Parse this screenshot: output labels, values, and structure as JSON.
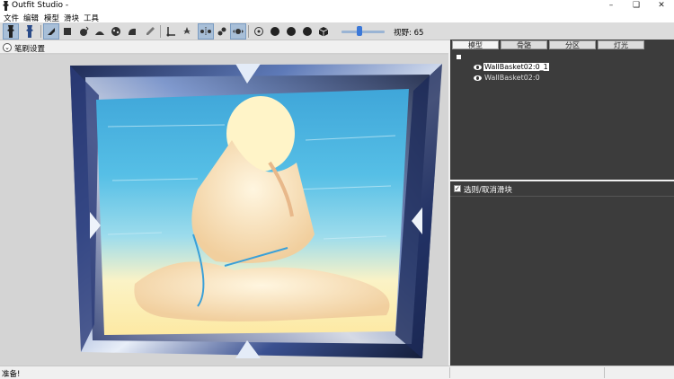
{
  "window": {
    "title": "Outfit Studio -"
  },
  "menu": [
    "文件",
    "编辑",
    "模型",
    "滑块",
    "工具"
  ],
  "toolbar": {
    "icons": [
      "select-tool-icon",
      "transform-tool-icon",
      "brush-standard-icon",
      "brush-mask-icon",
      "brush-inflate-icon",
      "brush-deflate-icon",
      "brush-move-icon",
      "brush-smooth-icon",
      "brush-weight-icon",
      "brush-color-icon",
      "brush-alpha-icon",
      "anchor-icon",
      "collision-icon",
      "xmirror-icon",
      "connected-icon",
      "vertex-icon",
      "wireframe-icon",
      "lighting-icon",
      "texture-icon"
    ],
    "fov_label": "视野: 65",
    "fov_value": 65
  },
  "brush_settings": {
    "label": "笔刷设置"
  },
  "right_tabs": [
    "模型",
    "骨骼",
    "分区",
    "灯光"
  ],
  "shapes": [
    {
      "name": "WallBasket02:0_1",
      "selected": true
    },
    {
      "name": "WallBasket02:0",
      "selected": false
    }
  ],
  "sliders_panel": {
    "label": "选则/取消滑块"
  },
  "status": {
    "text": "准备!"
  },
  "colors": {
    "viewport_bg": "#d4d4d4",
    "dark_panel": "#3c3c3c",
    "accent": "#3b78d8"
  }
}
